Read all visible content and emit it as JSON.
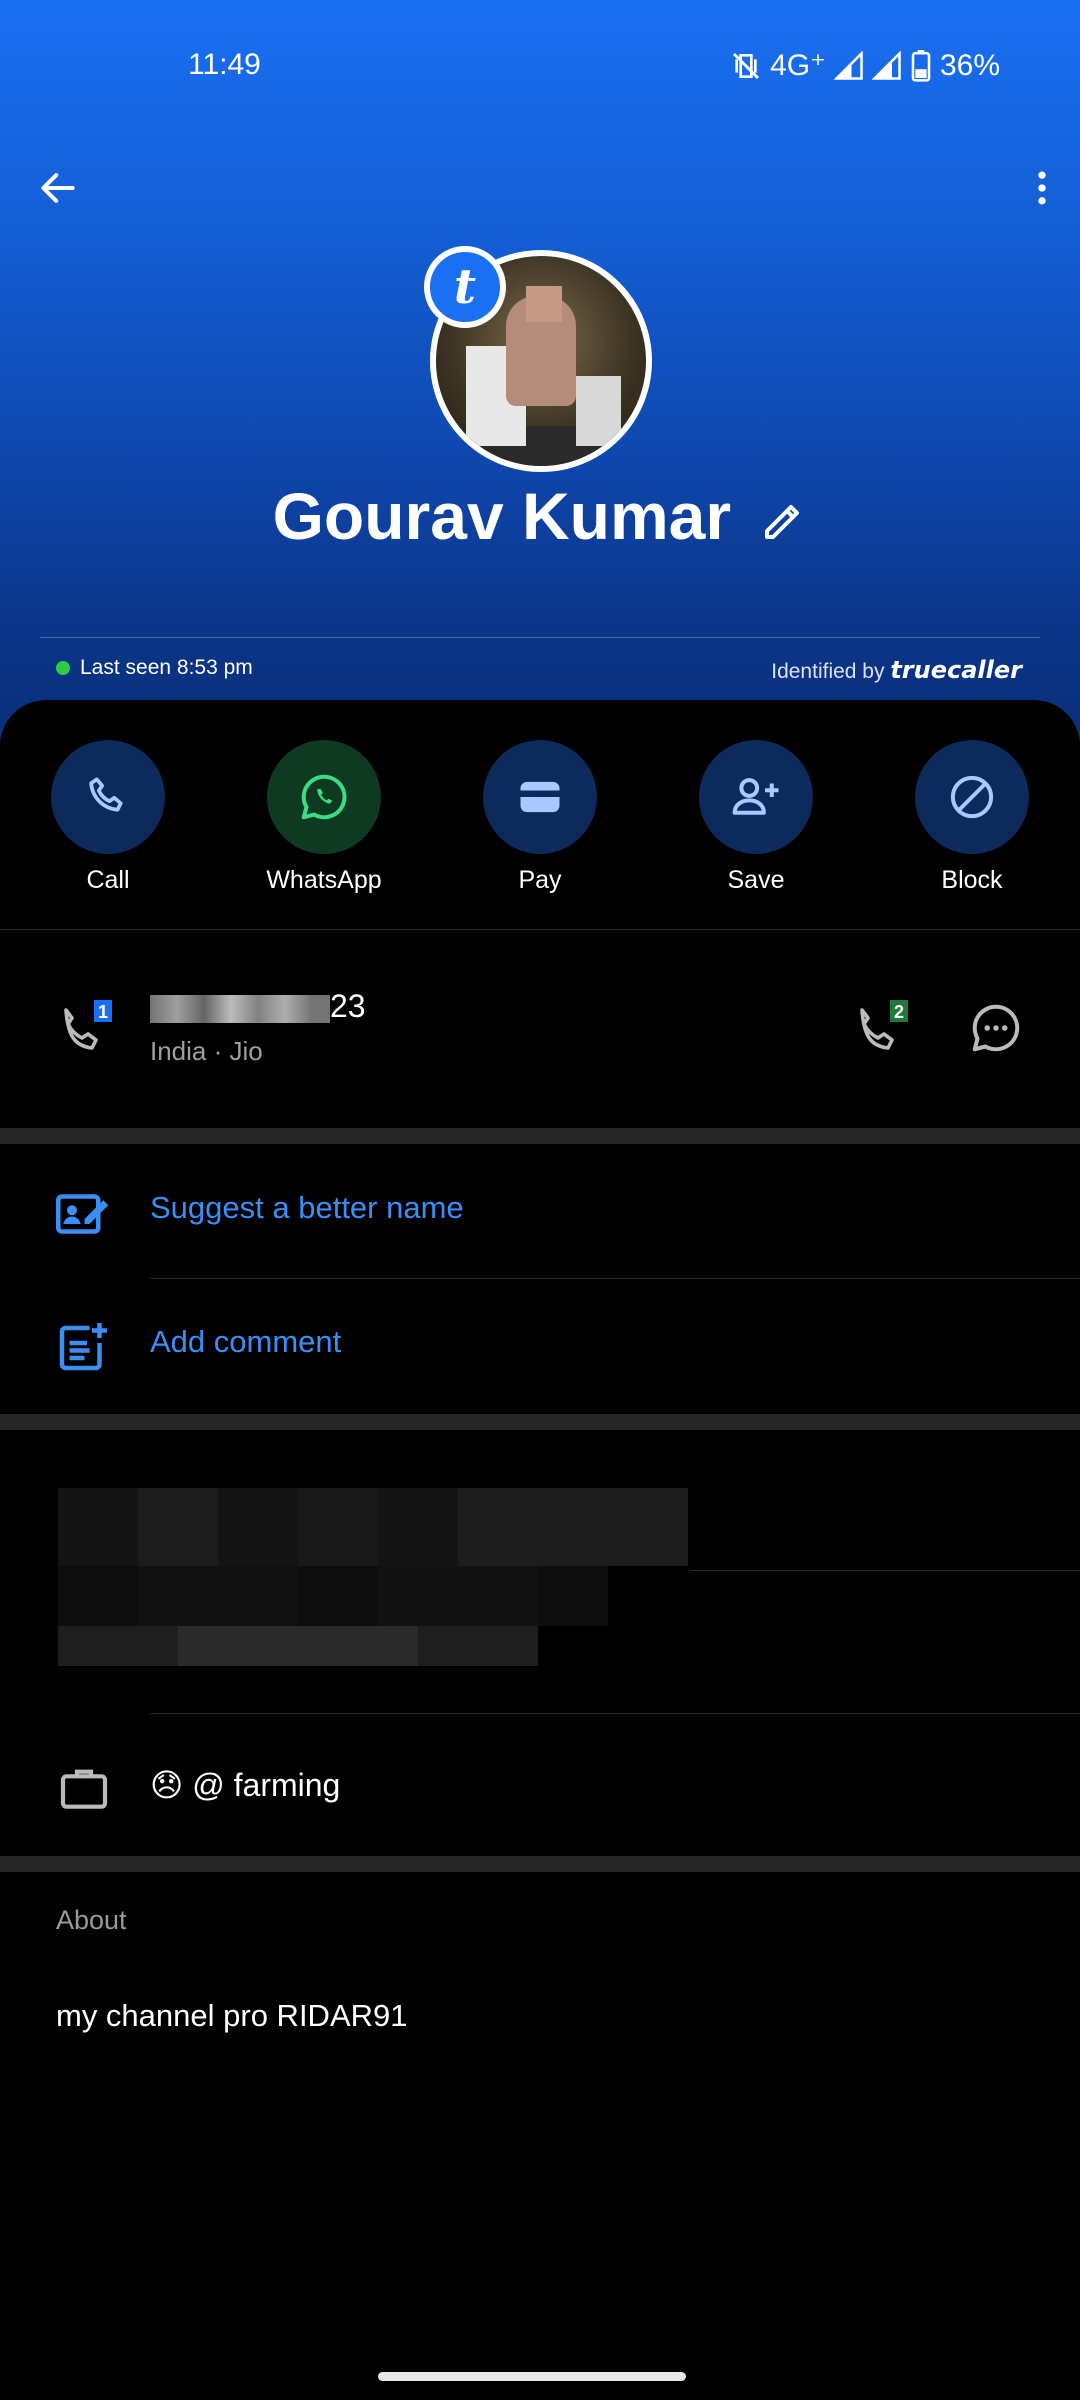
{
  "status_bar": {
    "time": "11:49",
    "network": "4G⁺",
    "battery": "36%"
  },
  "header": {
    "name": "Gourav Kumar",
    "badge_letter": "t",
    "last_seen": "Last seen 8:53 pm",
    "identified_prefix": "Identified by",
    "identified_brand": "truecaller"
  },
  "actions": [
    {
      "label": "Call",
      "icon": "phone-icon"
    },
    {
      "label": "WhatsApp",
      "icon": "whatsapp-icon"
    },
    {
      "label": "Pay",
      "icon": "wallet-icon"
    },
    {
      "label": "Save",
      "icon": "add-person-icon"
    },
    {
      "label": "Block",
      "icon": "block-icon"
    }
  ],
  "phone": {
    "number_suffix": "23",
    "carrier": "India · Jio",
    "sim1_badge": "1",
    "sim2_badge": "2"
  },
  "links": {
    "suggest": "Suggest a better name",
    "comment": "Add comment"
  },
  "work": {
    "text": "😞 @ farming"
  },
  "about": {
    "label": "About",
    "text": "my channel pro RIDAR91"
  },
  "colors": {
    "accent": "#3a8ef6",
    "header_top": "#1a6ff2",
    "online": "#2ecc40"
  }
}
